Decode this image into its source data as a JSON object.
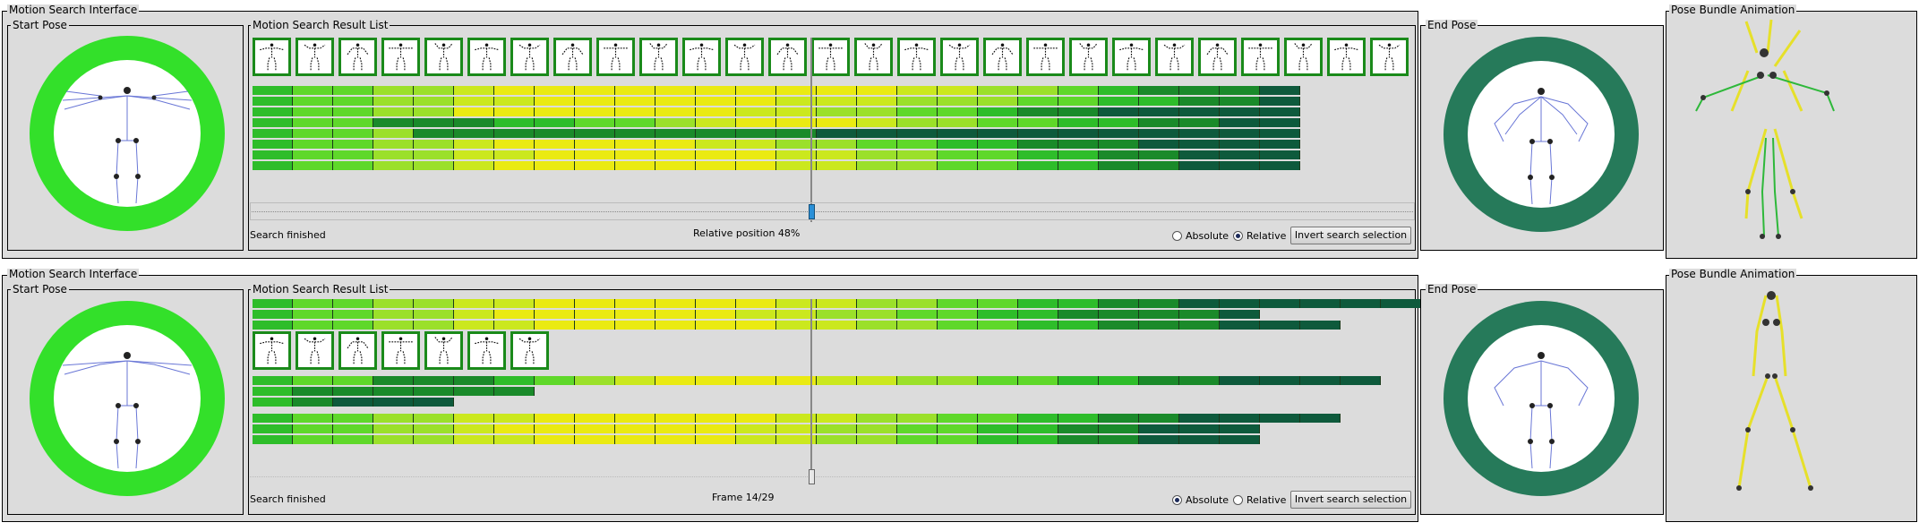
{
  "colors": {
    "panel_bg": "#dcdcdc",
    "ring_bright": "#33e02a",
    "ring_dark": "#267a5a",
    "bar_palette": [
      "#0e5a3c",
      "#1a8a2a",
      "#2ebd2a",
      "#5fd82a",
      "#9be02a",
      "#cbe81e",
      "#eaea12"
    ],
    "thumb_border": "#1a8a1a",
    "skeleton_yellow": "#e6e02a",
    "skeleton_green": "#2eb83a"
  },
  "icons": [
    "stick-figure-icon",
    "skeleton-icon",
    "radio-button-icon"
  ],
  "top": {
    "main_title": "Motion Search Interface",
    "start_pose_title": "Start Pose",
    "result_list_title": "Motion Search Result List",
    "end_pose_title": "End Pose",
    "pose_bundle_title": "Pose Bundle Animation",
    "status": "Search finished",
    "position_label": "Relative position 48%",
    "radio_absolute": "Absolute",
    "radio_relative": "Relative",
    "selected_mode": "Relative",
    "invert_button": "Invert search selection",
    "slider_value": 0.48,
    "thumbnail_count": 27
  },
  "bottom": {
    "main_title": "Motion Search Interface",
    "start_pose_title": "Start Pose",
    "result_list_title": "Motion Search Result List",
    "end_pose_title": "End Pose",
    "pose_bundle_title": "Pose Bundle Animation",
    "status": "Search finished",
    "position_label": "Frame 14/29",
    "radio_absolute": "Absolute",
    "radio_relative": "Relative",
    "selected_mode": "Absolute",
    "invert_button": "Invert search selection",
    "slider_value": 0.48,
    "thumbnail_count": 7
  }
}
